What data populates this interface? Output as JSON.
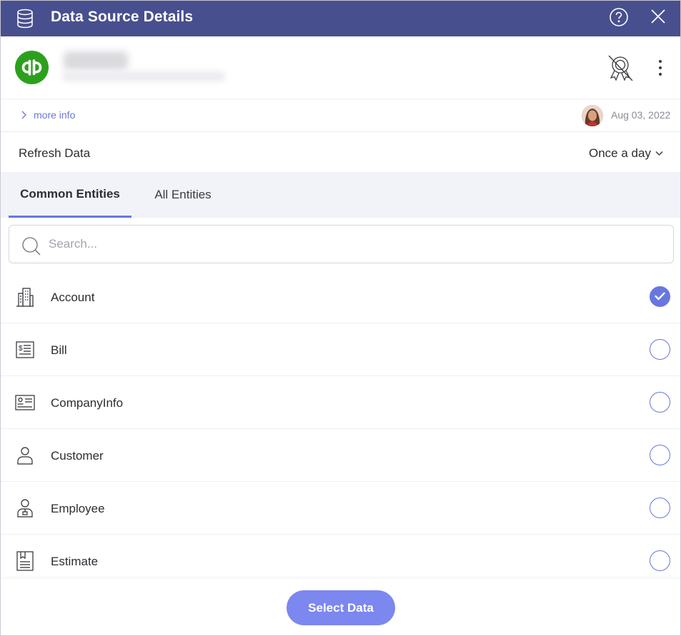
{
  "window": {
    "title": "Data Source Details",
    "help_icon": "help-circle-icon",
    "close_icon": "close-icon"
  },
  "source": {
    "logo": "quickbooks-logo",
    "name": "Serach",
    "email": "redacted@example.com"
  },
  "info": {
    "more_info_label": "more info",
    "date": "Aug 03, 2022"
  },
  "refresh": {
    "label": "Refresh Data",
    "value": "Once a day"
  },
  "tabs": [
    {
      "label": "Common Entities",
      "active": true
    },
    {
      "label": "All Entities",
      "active": false
    }
  ],
  "search": {
    "placeholder": "Search...",
    "value": ""
  },
  "entities": [
    {
      "label": "Account",
      "icon": "building-icon",
      "selected": true
    },
    {
      "label": "Bill",
      "icon": "bill-icon",
      "selected": false
    },
    {
      "label": "CompanyInfo",
      "icon": "id-card-icon",
      "selected": false
    },
    {
      "label": "Customer",
      "icon": "person-icon",
      "selected": false
    },
    {
      "label": "Employee",
      "icon": "employee-icon",
      "selected": false
    },
    {
      "label": "Estimate",
      "icon": "estimate-icon",
      "selected": false
    }
  ],
  "footer": {
    "select_label": "Select Data"
  },
  "colors": {
    "titlebar": "#484f8e",
    "accent": "#6877e0",
    "button": "#7c87ef",
    "logo_green": "#2ca01c"
  }
}
